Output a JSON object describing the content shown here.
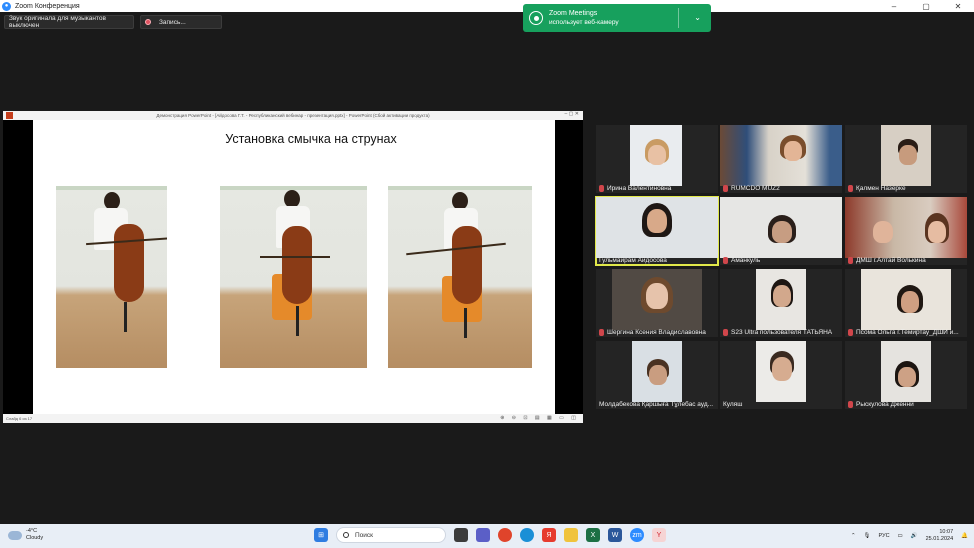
{
  "window": {
    "title": "Zoom Конференция",
    "controls": [
      "–",
      "▢",
      "✕"
    ]
  },
  "toolbar": {
    "original_sound": "Звук оригинала для музыкантов выключен",
    "record": "Запись..."
  },
  "notification": {
    "line1": "Zoom Meetings",
    "line2": "использует веб-камеру"
  },
  "share": {
    "window_title": "Демонстрация PowerPoint - [Айдосова Г.Т. - Республиканский вебинар - презентация.pptx] - PowerPoint (Сбой активации продукта)",
    "window_controls": "–  ▢  ✕",
    "slide_title": "Установка смычка на струнах",
    "status_left": "Слайд 6 из 17",
    "status_right": "⊕ ⊖ ⊡ ▤ ▦ ▭ ◫"
  },
  "participants": [
    {
      "name": "Ирина Валентиновна",
      "muted": true
    },
    {
      "name": "RUMCDO MUZ2",
      "muted": true
    },
    {
      "name": "Қалмен Назерке",
      "muted": true
    },
    {
      "name": "Гульмайрам Айдосова",
      "muted": false
    },
    {
      "name": "Аманкуль",
      "muted": true
    },
    {
      "name": "ДМШ г.Алтай Волькина",
      "muted": true
    },
    {
      "name": "Шергина Ксения Владиславовна",
      "muted": true
    },
    {
      "name": "S23 Ultra пользователя ТАТЬЯНА",
      "muted": true
    },
    {
      "name": "Псома Ольга г.Темиртау_ДШИ и...",
      "muted": true
    },
    {
      "name": "Молдабекова Қаршыға Тұлебас ауд...",
      "muted": false
    },
    {
      "name": "Куляш",
      "muted": false
    },
    {
      "name": "Рыскулова Дженни",
      "muted": true
    }
  ],
  "taskbar": {
    "weather_temp": "-4°C",
    "weather_desc": "Cloudy",
    "search_placeholder": "Поиск",
    "lang": "РУС",
    "time": "10:07",
    "date": "25.01.2024"
  }
}
